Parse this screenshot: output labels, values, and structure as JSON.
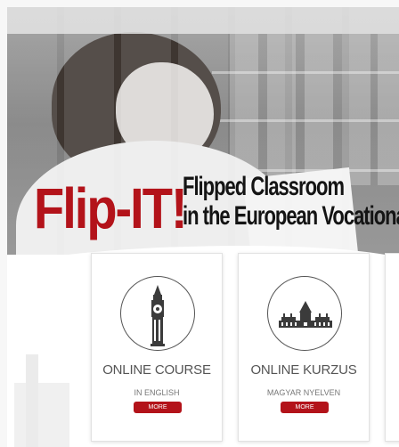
{
  "hero": {
    "logo_text": "Flip-IT!",
    "subtitle_line1": "Flipped Classroom",
    "subtitle_line2": "in the European Vocational"
  },
  "cards": [
    {
      "title": "ONLINE COURSE",
      "subtitle": "IN ENGLISH",
      "button_label": "MORE",
      "icon": "big-ben-icon"
    },
    {
      "title": "ONLINE KURZUS",
      "subtitle": "MAGYAR NYELVEN",
      "button_label": "MORE",
      "icon": "parliament-icon"
    }
  ],
  "colors": {
    "brand_red": "#b3131a",
    "text_gray": "#555555"
  }
}
